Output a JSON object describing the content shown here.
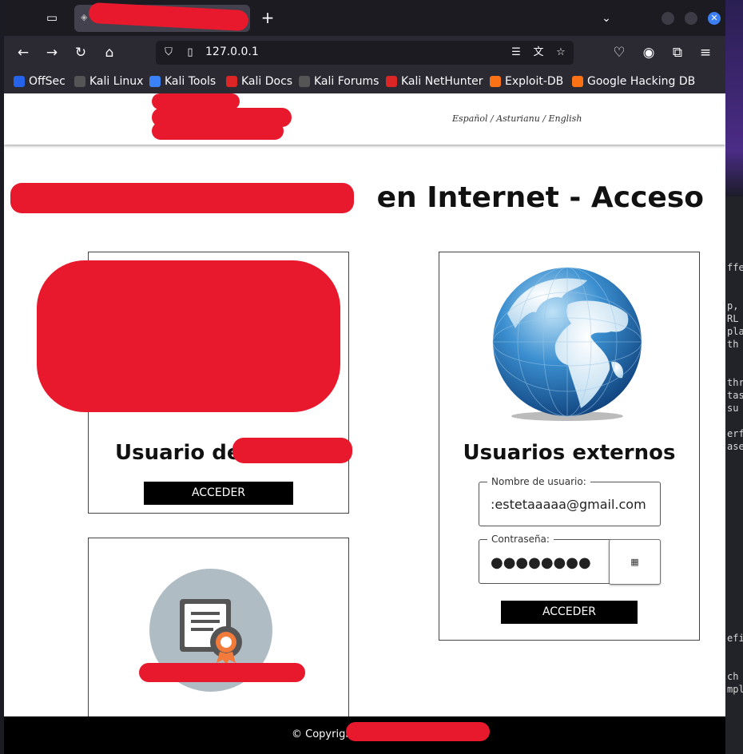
{
  "browser": {
    "tab_title": "",
    "address": "127.0.0.1",
    "bookmarks": [
      {
        "label": "OffSec",
        "color": "#2563eb"
      },
      {
        "label": "Kali Linux",
        "color": "#666666"
      },
      {
        "label": "Kali Tools",
        "color": "#3b82f6"
      },
      {
        "label": "Kali Docs",
        "color": "#dc2626"
      },
      {
        "label": "Kali Forums",
        "color": "#666666"
      },
      {
        "label": "Kali NetHunter",
        "color": "#dc2626"
      },
      {
        "label": "Exploit-DB",
        "color": "#f97316"
      },
      {
        "label": "Google Hacking DB",
        "color": "#f97316"
      }
    ]
  },
  "site": {
    "languages": "Español / Asturianu / English",
    "title": "en Internet - Acceso",
    "internal_card": {
      "title": "Usuario de",
      "button": "ACCEDER"
    },
    "external_card": {
      "title": "Usuarios externos",
      "username_label": "Nombre de usuario:",
      "username_value": ":estetaaaaa@gmail.com",
      "password_label": "Contraseña:",
      "password_value": "●●●●●●●●",
      "button": "ACCEDER"
    },
    "footer": "© Copyrigh"
  },
  "colors": {
    "redaction": "#e8192c",
    "tab_active": "#42414d",
    "toolbar": "#2b2a33",
    "close_button": "#3c7ff5"
  }
}
